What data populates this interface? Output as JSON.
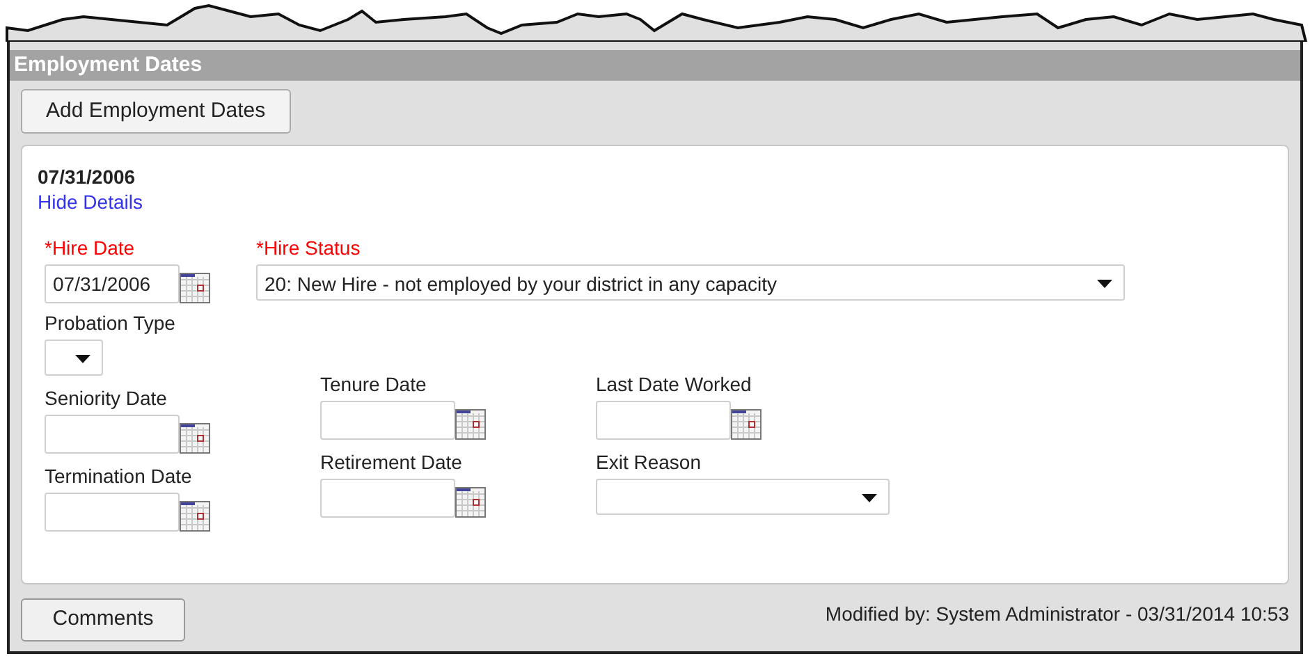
{
  "section": {
    "title": "Employment Dates"
  },
  "add_button": "Add Employment Dates",
  "record": {
    "heading": "07/31/2006",
    "toggle_link": "Hide Details",
    "top_fields": [
      {
        "kind": "date",
        "label": "*Hire Date",
        "required": true,
        "value": "07/31/2006"
      },
      {
        "kind": "select",
        "label": "*Hire Status",
        "required": true,
        "value": "20: New Hire - not employed by your district in any capacity"
      }
    ],
    "columns": [
      [
        {
          "kind": "select",
          "label": "Probation Type",
          "required": false
        },
        {
          "kind": "date",
          "label": "Seniority Date",
          "required": false
        },
        {
          "kind": "date",
          "label": "Termination Date",
          "required": false
        }
      ],
      [
        {
          "kind": "date",
          "label": "Tenure Date",
          "required": false
        },
        {
          "kind": "date",
          "label": "Retirement Date",
          "required": false
        }
      ],
      [
        {
          "kind": "date",
          "label": "Last Date Worked",
          "required": false
        },
        {
          "kind": "select",
          "label": "Exit Reason",
          "required": false
        }
      ]
    ]
  },
  "comments_button": "Comments",
  "modified_note": "Modified by: System Administrator - 03/31/2014 10:53"
}
